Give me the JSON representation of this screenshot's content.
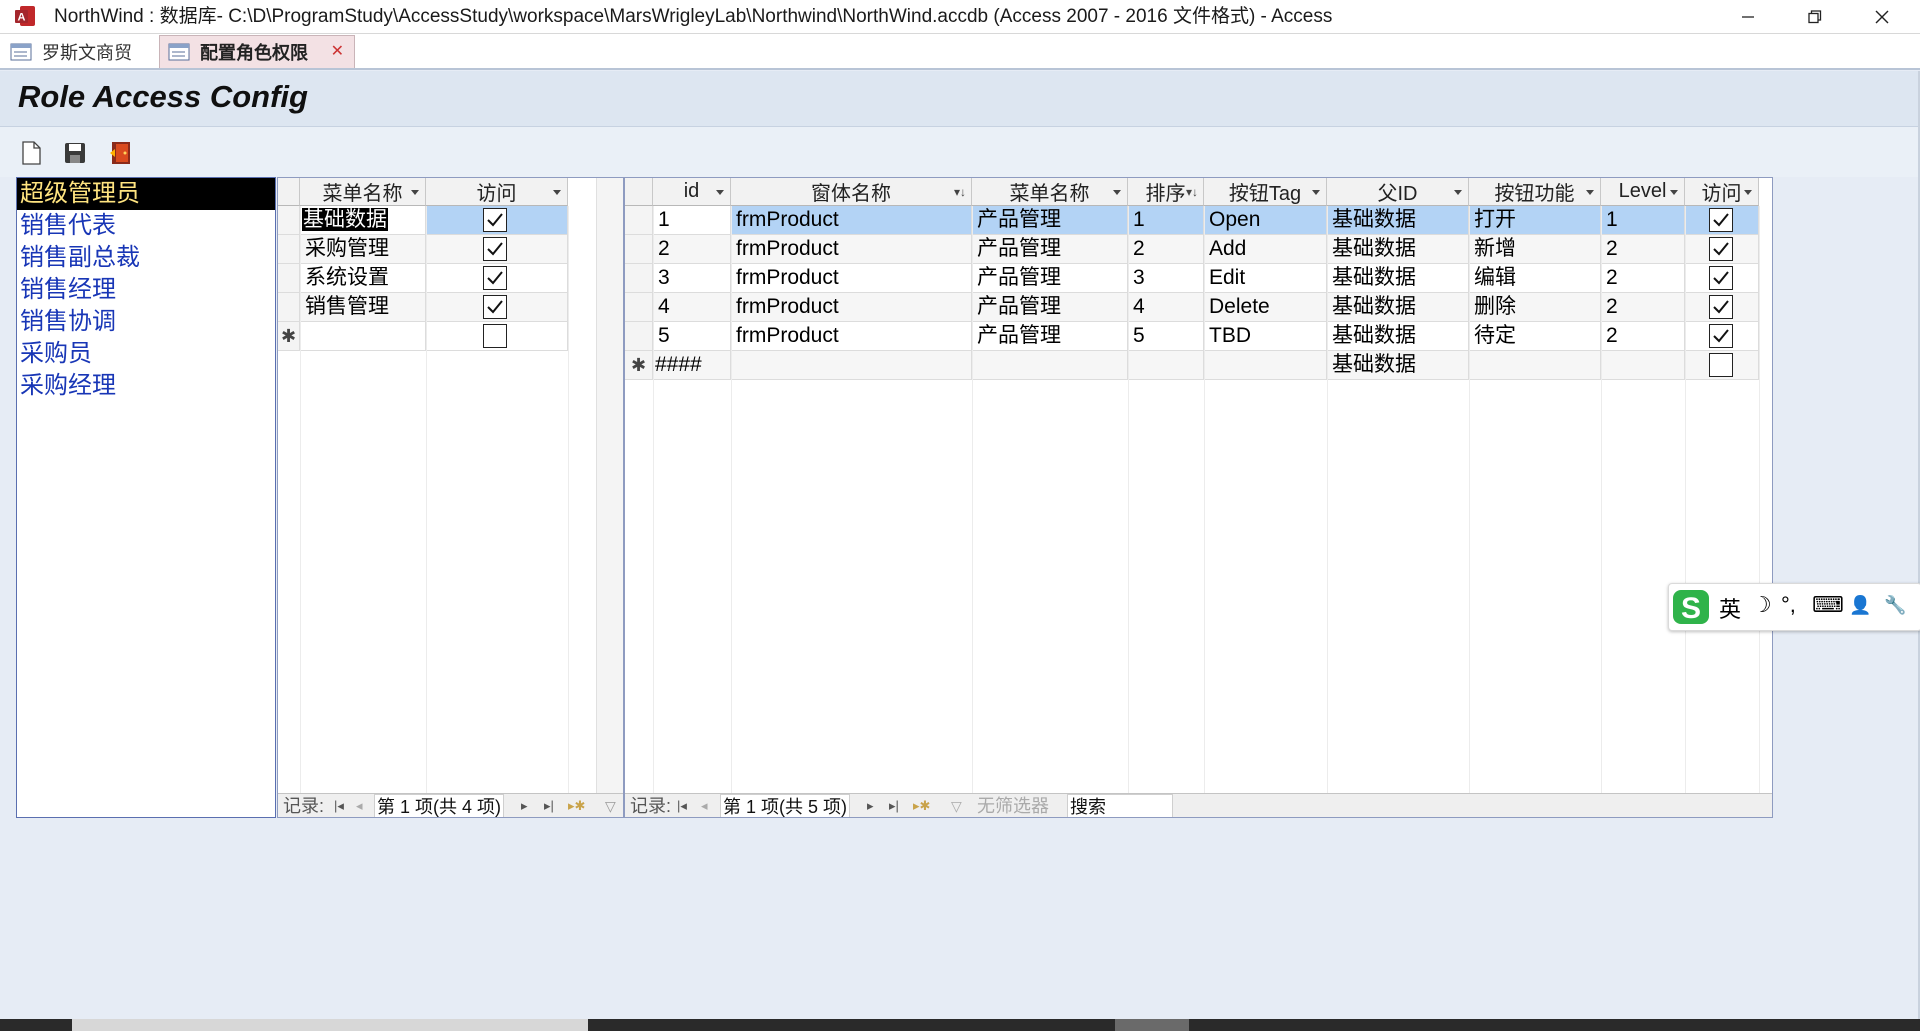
{
  "window": {
    "title": "NorthWind : 数据库- C:\\D\\ProgramStudy\\AccessStudy\\workspace\\MarsWrigleyLab\\Northwind\\NorthWind.accdb (Access 2007 - 2016 文件格式) - Access",
    "app_icon": "access-icon",
    "min_glyph": "—",
    "restore_glyph": "❐",
    "close_glyph": "✕"
  },
  "tabs": [
    {
      "label": "罗斯文商贸",
      "icon": "form-icon",
      "active": false
    },
    {
      "label": "配置角色权限",
      "icon": "form-icon",
      "active": true
    }
  ],
  "tab_close_glyph": "✕",
  "form": {
    "title": "Role Access Config"
  },
  "toolbar": {
    "icons": [
      "new-document-icon",
      "save-icon",
      "exit-door-icon"
    ]
  },
  "roles": [
    "超级管理员",
    "销售代表",
    "销售副总裁",
    "销售经理",
    "销售协调",
    "采购员",
    "采购经理"
  ],
  "selected_role": "超级管理员",
  "menu_sheet": {
    "columns": [
      "菜单名称",
      "访问"
    ],
    "rows": [
      {
        "menu": "基础数据",
        "access": true
      },
      {
        "menu": "采购管理",
        "access": true
      },
      {
        "menu": "系统设置",
        "access": true
      },
      {
        "menu": "销售管理",
        "access": true
      }
    ],
    "new_row_marker": "✱",
    "nav": {
      "label": "记录:",
      "position": "第 1 项(共 4 项)"
    }
  },
  "detail_sheet": {
    "columns": [
      "id",
      "窗体名称",
      "菜单名称",
      "排序",
      "按钮Tag",
      "父ID",
      "按钮功能",
      "Level",
      "访问"
    ],
    "rows": [
      {
        "id": "1",
        "form": "frmProduct",
        "menu": "产品管理",
        "sort": "1",
        "tag": "Open",
        "parent": "基础数据",
        "func": "打开",
        "level": "1",
        "access": true
      },
      {
        "id": "2",
        "form": "frmProduct",
        "menu": "产品管理",
        "sort": "2",
        "tag": "Add",
        "parent": "基础数据",
        "func": "新增",
        "level": "2",
        "access": true
      },
      {
        "id": "3",
        "form": "frmProduct",
        "menu": "产品管理",
        "sort": "3",
        "tag": "Edit",
        "parent": "基础数据",
        "func": "编辑",
        "level": "2",
        "access": true
      },
      {
        "id": "4",
        "form": "frmProduct",
        "menu": "产品管理",
        "sort": "4",
        "tag": "Delete",
        "parent": "基础数据",
        "func": "删除",
        "level": "2",
        "access": true
      },
      {
        "id": "5",
        "form": "frmProduct",
        "menu": "产品管理",
        "sort": "5",
        "tag": "TBD",
        "parent": "基础数据",
        "func": "待定",
        "level": "2",
        "access": true
      }
    ],
    "new_row": {
      "id": "####",
      "parent": "基础数据",
      "access": false
    },
    "new_row_marker": "✱",
    "nav": {
      "label": "记录:",
      "position": "第 1 项(共 5 项)",
      "filter": "无筛选器",
      "search": "搜索"
    }
  },
  "nav_glyphs": {
    "first": "|◂",
    "prev": "◂",
    "next": "▸",
    "last": "▸|",
    "new": "▸✱"
  },
  "ime": {
    "logo": "S",
    "mode": "英",
    "moon": "☽",
    "punct": "°,",
    "keyboard": "⌨",
    "user": "👤",
    "tools": "🔧"
  },
  "colors": {
    "selected_row": "#b3d3f5",
    "role_link": "#1836b6",
    "role_selected_fg": "#ffe480"
  }
}
